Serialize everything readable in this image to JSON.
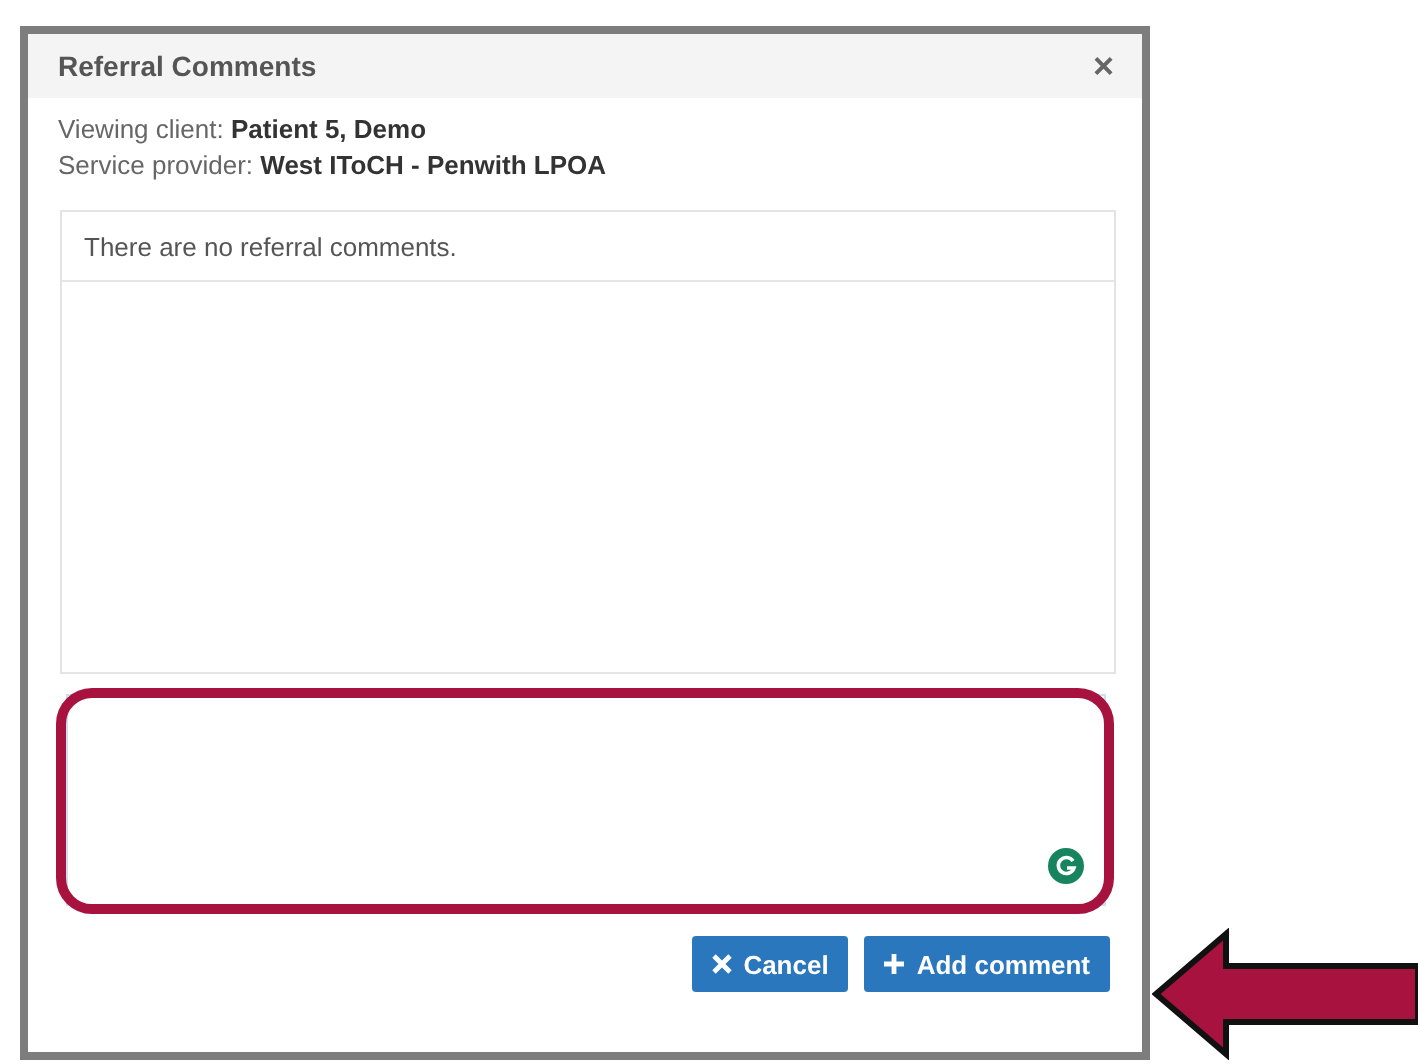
{
  "dialog": {
    "title": "Referral Comments",
    "close": "×"
  },
  "info": [
    {
      "label": "Viewing client:",
      "value": "Patient 5, Demo"
    },
    {
      "label": "Service provider:",
      "value": "West IToCH - Penwith LPOA"
    }
  ],
  "comments": {
    "empty_message": "There are no referral comments."
  },
  "comment_field": {
    "highlighted": true
  },
  "buttons": [
    {
      "kind": "cancel",
      "label": "Cancel"
    },
    {
      "kind": "add",
      "label": "Add comment"
    }
  ]
}
